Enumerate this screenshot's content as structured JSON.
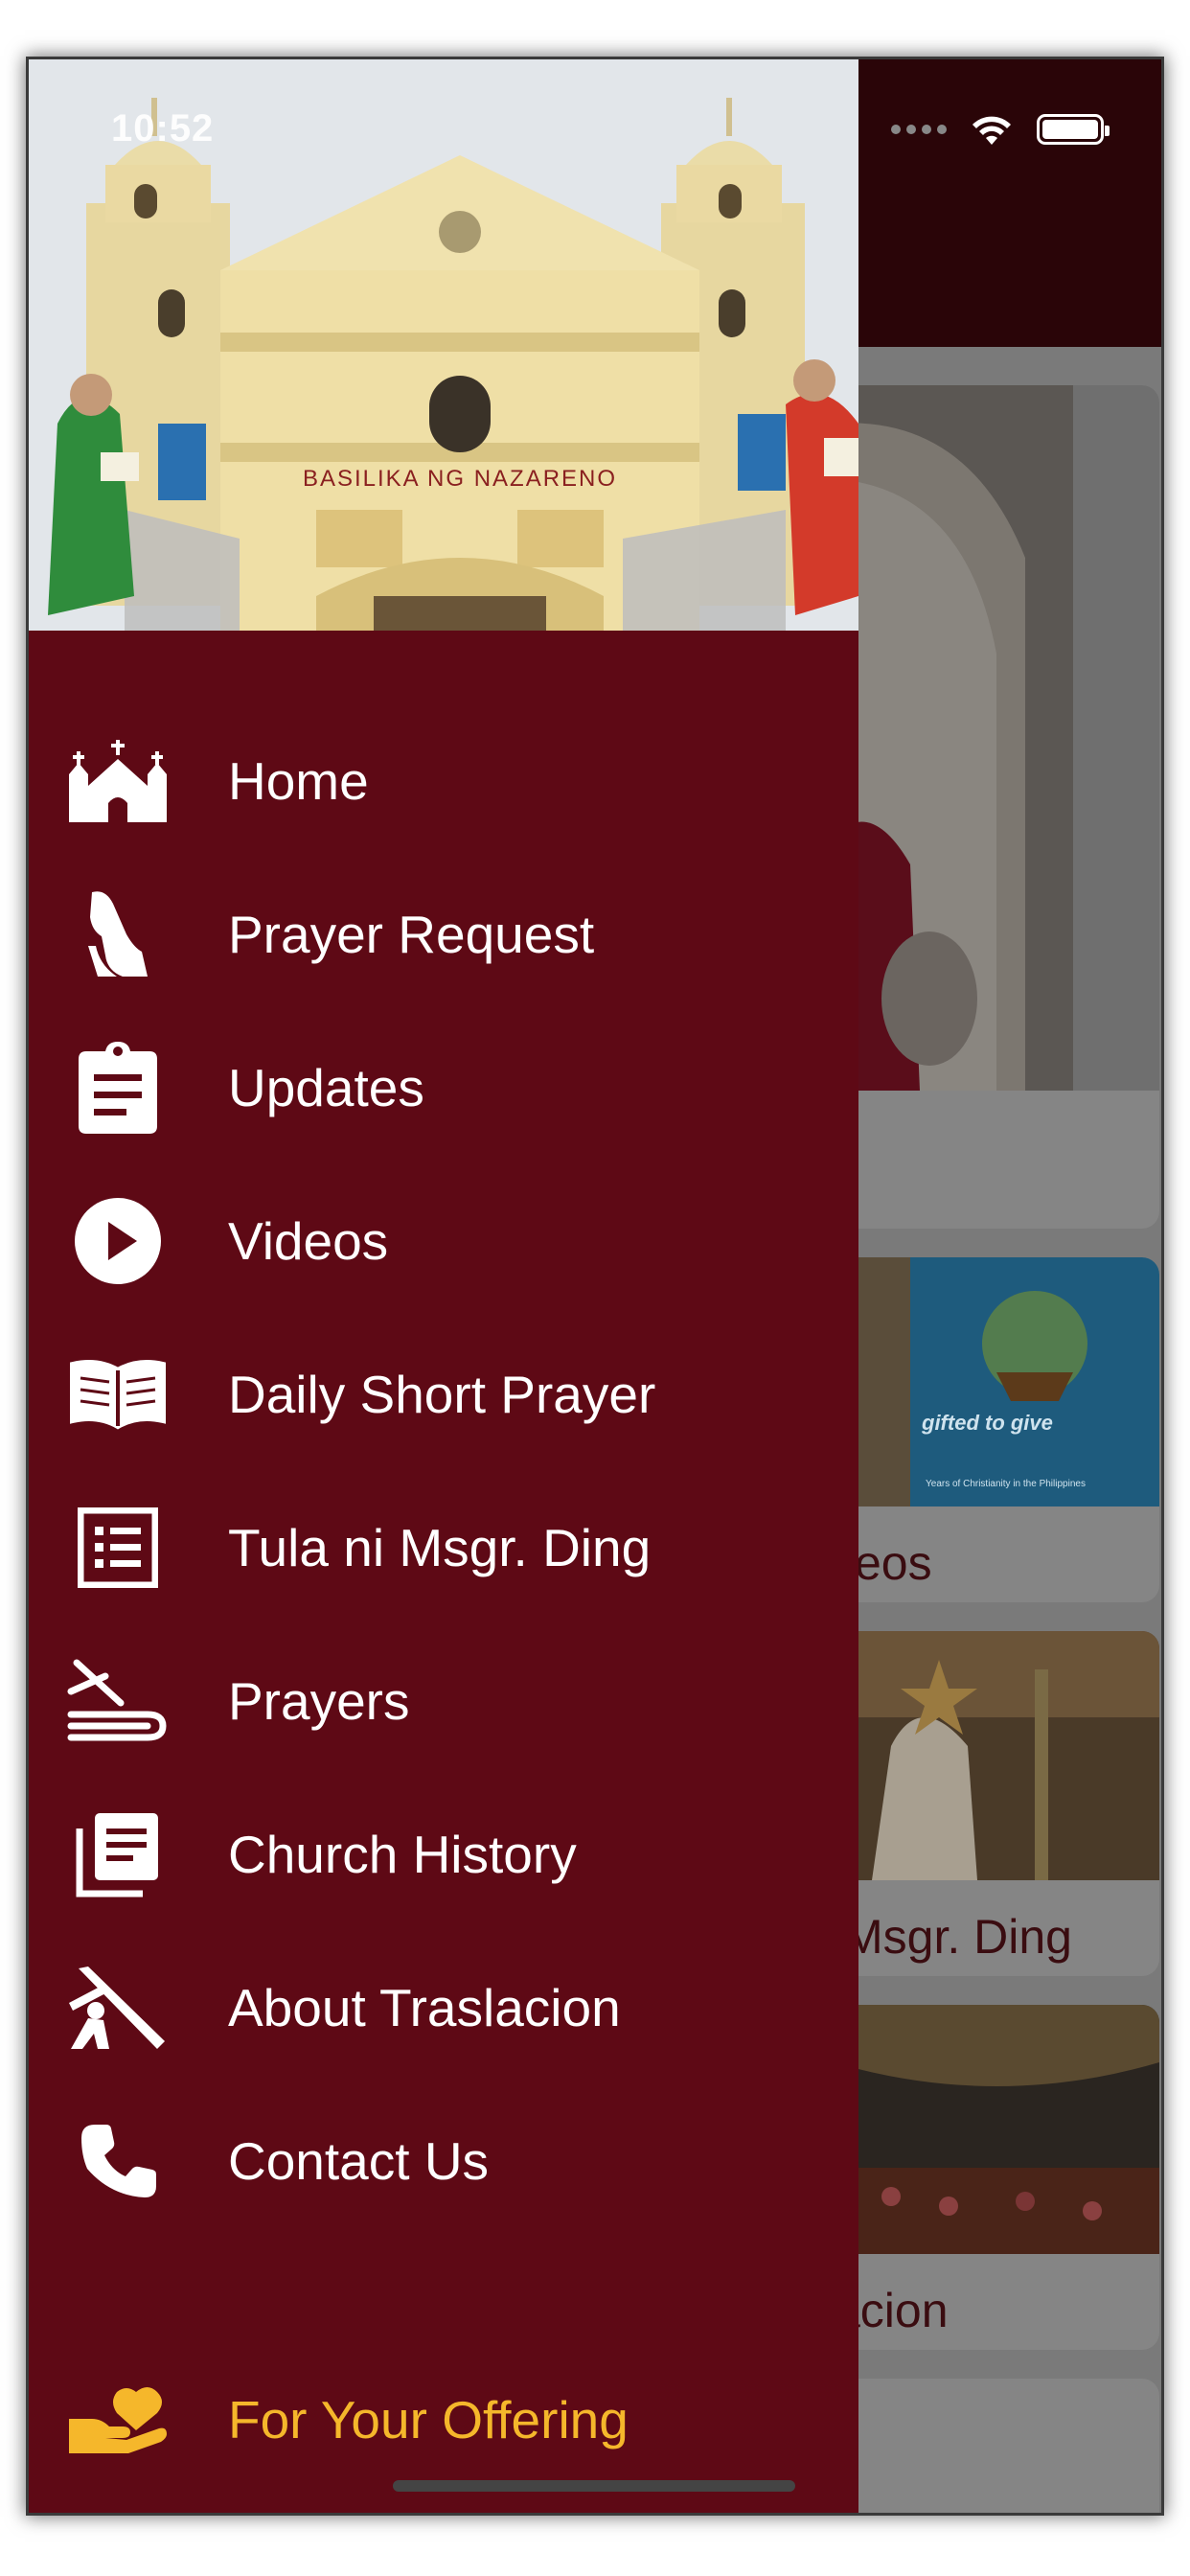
{
  "status_bar": {
    "time": "10:52"
  },
  "hero": {
    "facade_sign": "BASILIKA NG NAZARENO"
  },
  "menu": {
    "items": [
      {
        "label": "Home",
        "icon": "church-icon"
      },
      {
        "label": "Prayer Request",
        "icon": "praying-hands-icon"
      },
      {
        "label": "Updates",
        "icon": "clipboard-icon"
      },
      {
        "label": "Videos",
        "icon": "play-circle-icon"
      },
      {
        "label": "Daily Short Prayer",
        "icon": "open-book-icon"
      },
      {
        "label": "Tula ni Msgr. Ding",
        "icon": "list-document-icon"
      },
      {
        "label": "Prayers",
        "icon": "bible-icon"
      },
      {
        "label": "Church History",
        "icon": "library-books-icon"
      },
      {
        "label": "About Traslacion",
        "icon": "cross-carrier-icon"
      },
      {
        "label": "Contact Us",
        "icon": "phone-icon"
      }
    ],
    "offering": {
      "label": "For Your Offering",
      "icon": "hand-heart-icon"
    }
  },
  "background": {
    "cards": [
      {
        "label": ""
      },
      {
        "label": "eos",
        "image_text": "gifted to give",
        "image_subtext": "Years of Christianity in the Philippines"
      },
      {
        "label": "Msgr. Ding"
      },
      {
        "label": "acion"
      }
    ]
  },
  "colors": {
    "drawer_bg": "#5e0915",
    "offering_accent": "#f5b72b",
    "header_bg": "#2a0508"
  }
}
